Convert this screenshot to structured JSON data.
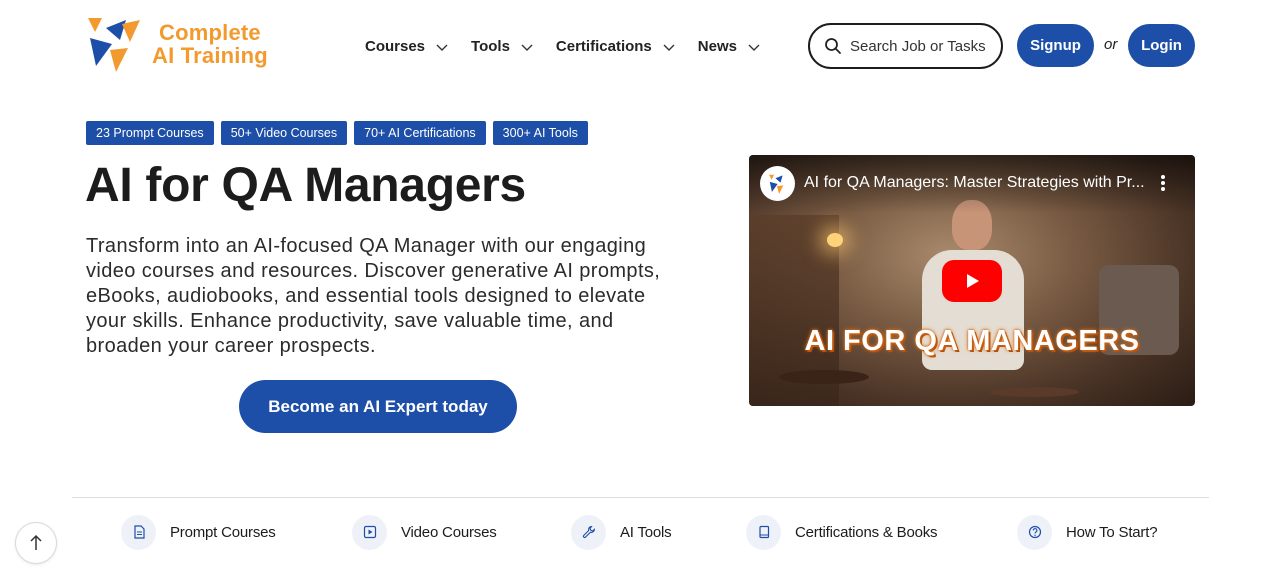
{
  "brand": {
    "line1": "Complete",
    "line2": "AI Training",
    "color": "#f39a2f"
  },
  "nav": {
    "items": [
      {
        "label": "Courses",
        "icon": "chevron-down-icon"
      },
      {
        "label": "Tools",
        "icon": "chevron-down-icon"
      },
      {
        "label": "Certifications",
        "icon": "chevron-down-icon"
      },
      {
        "label": "News",
        "icon": "chevron-down-icon"
      }
    ]
  },
  "search": {
    "placeholder": "Search Job or Tasks",
    "icon": "search-icon"
  },
  "auth": {
    "signup": "Signup",
    "or": "or",
    "login": "Login"
  },
  "badges": [
    "23 Prompt Courses",
    "50+ Video Courses",
    "70+ AI Certifications",
    "300+ AI Tools"
  ],
  "hero": {
    "title": "AI for QA Managers",
    "description": "Transform into an AI-focused QA Manager with our engaging video courses and resources. Discover generative AI prompts, eBooks, audiobooks, and essential tools designed to elevate your skills. Enhance productivity, save valuable time, and broaden your career prospects.",
    "cta": "Become an AI Expert today"
  },
  "video": {
    "title": "AI for QA Managers: Master Strategies with Pr...",
    "overlay_text": "AI FOR QA MANAGERS",
    "play_color": "#ff0000"
  },
  "features": [
    {
      "label": "Prompt Courses",
      "icon": "document-icon"
    },
    {
      "label": "Video Courses",
      "icon": "play-square-icon"
    },
    {
      "label": "AI Tools",
      "icon": "wrench-icon"
    },
    {
      "label": "Certifications & Books",
      "icon": "book-icon"
    },
    {
      "label": "How To Start?",
      "icon": "question-icon"
    }
  ],
  "colors": {
    "primary": "#1d4fa8",
    "accent": "#f39a2f"
  }
}
